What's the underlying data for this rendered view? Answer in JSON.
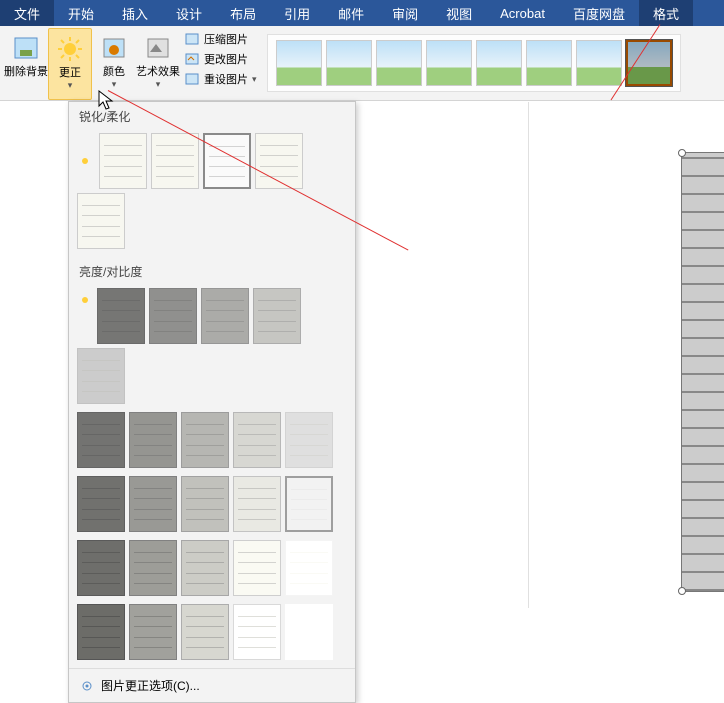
{
  "menubar": {
    "items": [
      {
        "label": "文件"
      },
      {
        "label": "开始"
      },
      {
        "label": "插入"
      },
      {
        "label": "设计"
      },
      {
        "label": "布局"
      },
      {
        "label": "引用"
      },
      {
        "label": "邮件"
      },
      {
        "label": "审阅"
      },
      {
        "label": "视图"
      },
      {
        "label": "Acrobat"
      },
      {
        "label": "百度网盘"
      },
      {
        "label": "格式"
      }
    ],
    "active_index": 11
  },
  "ribbon": {
    "remove_bg": "删除背景",
    "corrections": "更正",
    "color": "颜色",
    "artistic": "艺术效果",
    "compress": "压缩图片",
    "change": "更改图片",
    "reset": "重设图片"
  },
  "style_gallery_count": 8,
  "dropdown": {
    "section_sharpen": "锐化/柔化",
    "section_brightness": "亮度/对比度",
    "options_label": "图片更正选项(C)..."
  },
  "sharpen_thumbs": 5,
  "sharpen_selected": 2,
  "brightness_rows": 5,
  "brightness_cols": 5,
  "brightness_selected_index": 14,
  "colors": {
    "ribbon_blue": "#2b579a",
    "highlight": "#fce4a0"
  }
}
